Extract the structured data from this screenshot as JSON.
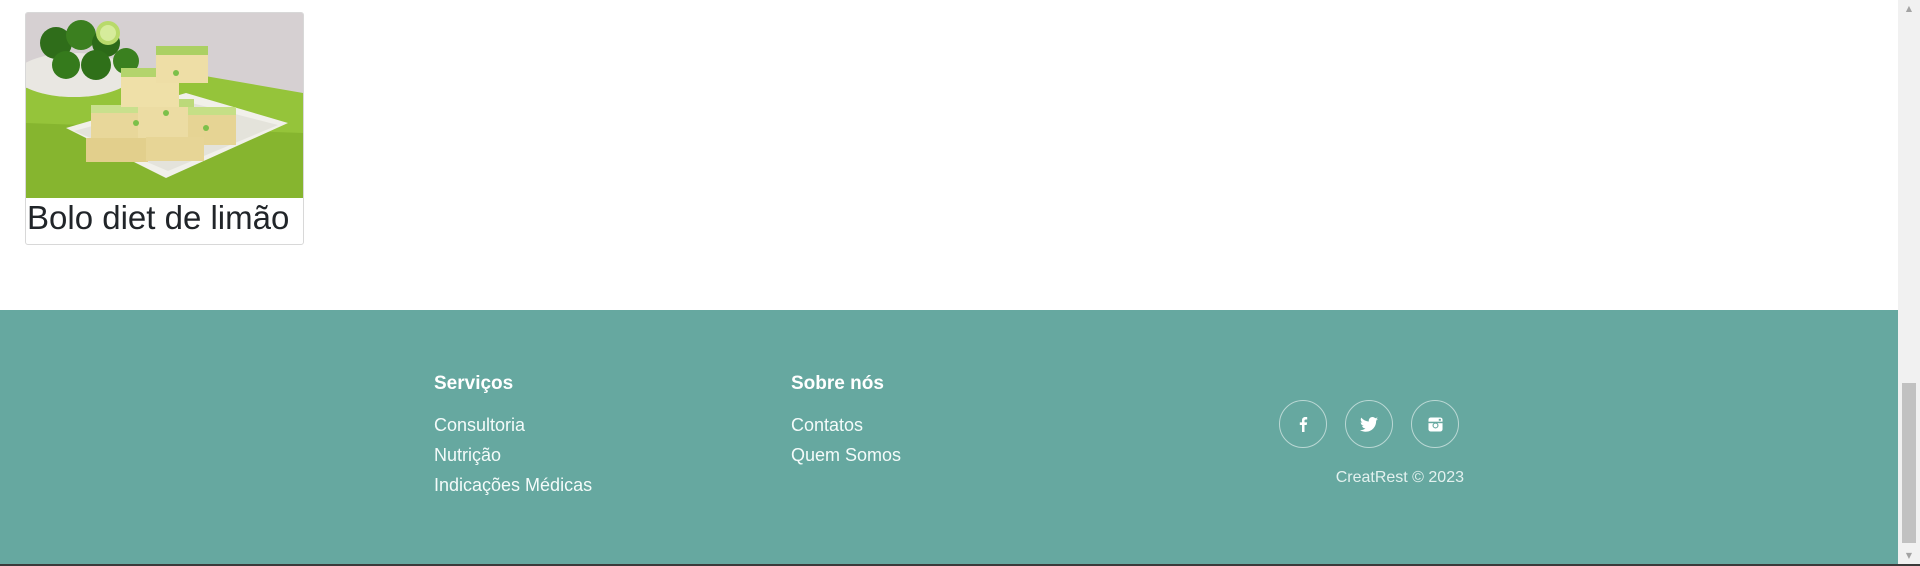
{
  "recipe_card": {
    "title": "Bolo diet de limão",
    "image_icon": "lime-cake-photo"
  },
  "footer": {
    "services": {
      "heading": "Serviços",
      "items": [
        "Consultoria",
        "Nutrição",
        "Indicações Médicas"
      ]
    },
    "about": {
      "heading": "Sobre nós",
      "items": [
        "Contatos",
        "Quem Somos"
      ]
    },
    "social": [
      "facebook-icon",
      "twitter-icon",
      "instagram-icon"
    ],
    "copyright": "CreatRest © 2023"
  },
  "colors": {
    "footer_bg": "#66a8a0",
    "text_light": "#ffffff"
  }
}
